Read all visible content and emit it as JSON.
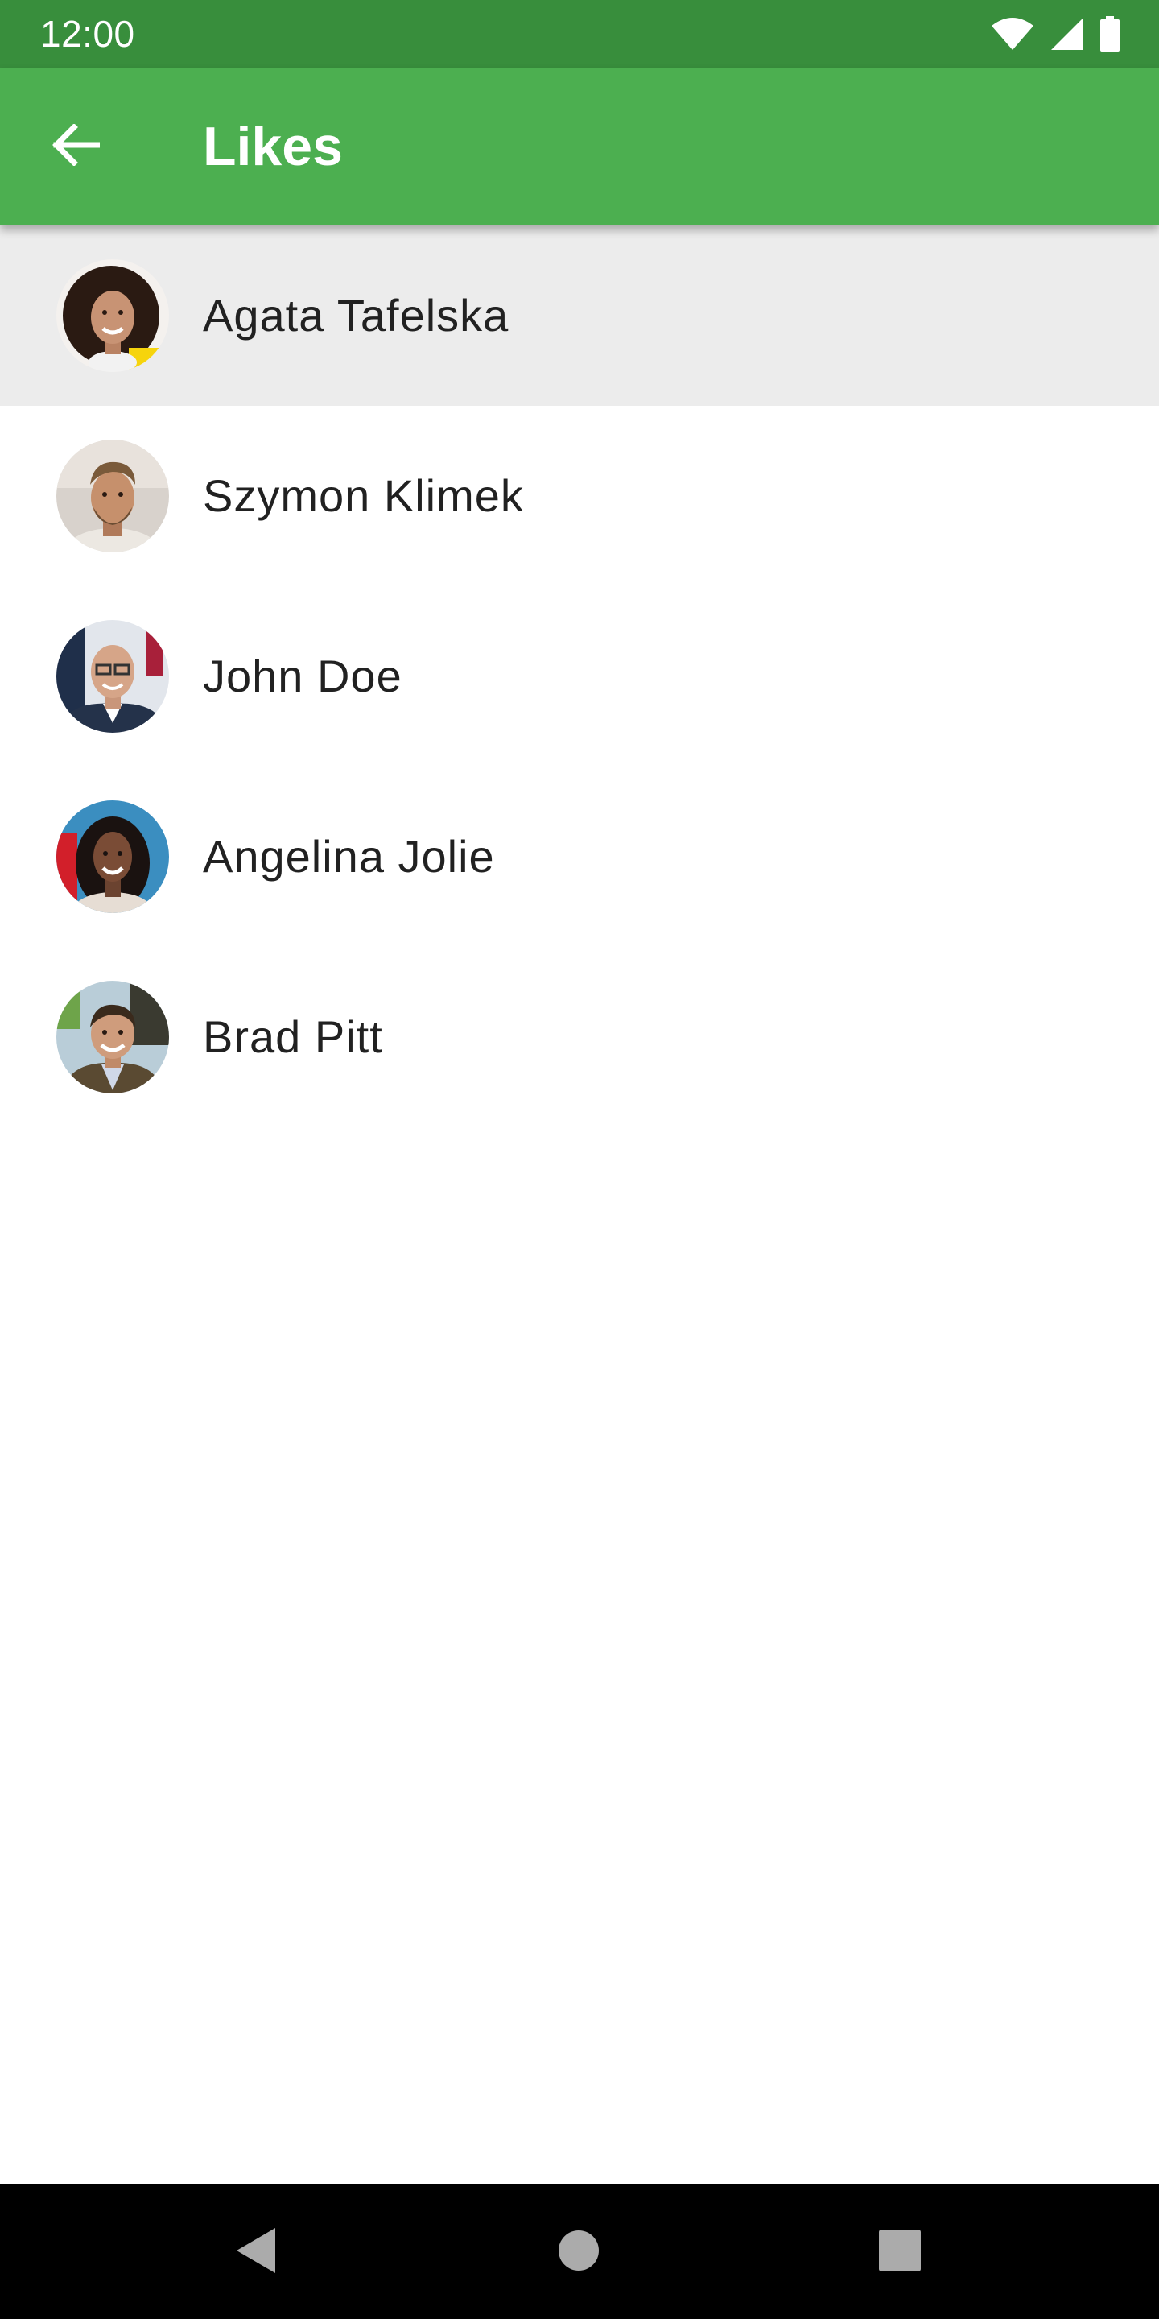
{
  "status_bar": {
    "time": "12:00",
    "icons": [
      "wifi-icon",
      "cellular-signal-icon",
      "battery-icon"
    ]
  },
  "app_bar": {
    "back_icon": "arrow-left-icon",
    "title": "Likes"
  },
  "likes": [
    {
      "name": "Agata Tafelska",
      "avatar": "avatar-photo",
      "selected": true
    },
    {
      "name": "Szymon Klimek",
      "avatar": "avatar-photo",
      "selected": false
    },
    {
      "name": "John Doe",
      "avatar": "avatar-photo",
      "selected": false
    },
    {
      "name": "Angelina Jolie",
      "avatar": "avatar-photo",
      "selected": false
    },
    {
      "name": "Brad Pitt",
      "avatar": "avatar-photo",
      "selected": false
    }
  ],
  "nav_bar": {
    "icons": [
      "nav-back-icon",
      "nav-home-icon",
      "nav-recents-icon"
    ]
  },
  "colors": {
    "status_bar": "#388e3c",
    "app_bar": "#4caf50",
    "selected_row": "#ececec",
    "text_primary": "#212121",
    "nav_bar": "#000000"
  }
}
